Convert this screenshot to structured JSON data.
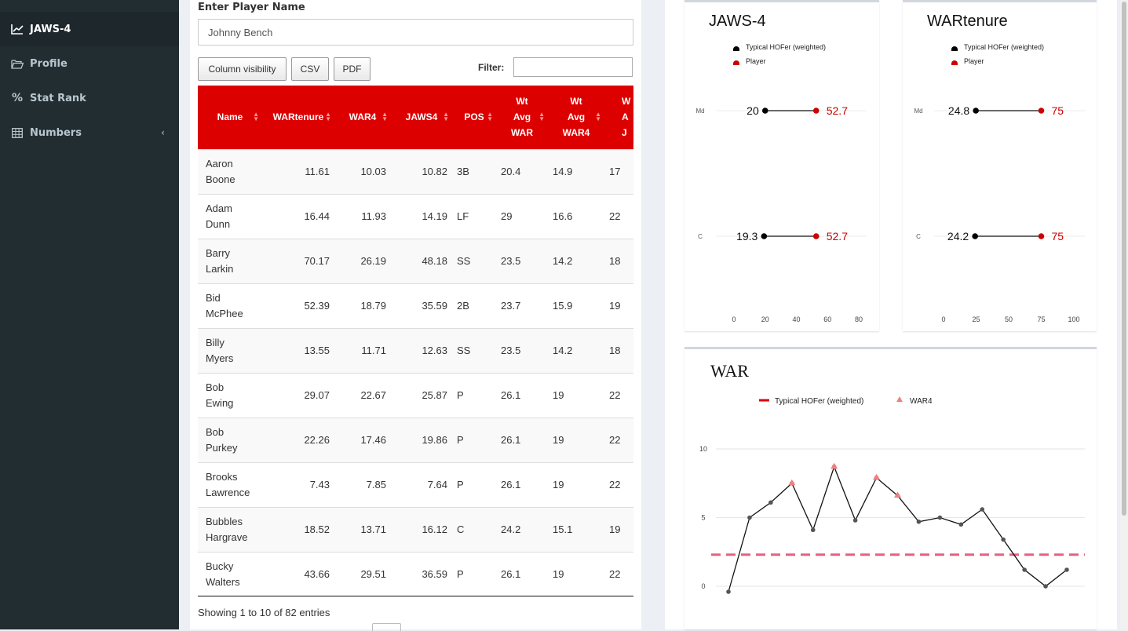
{
  "sidebar": {
    "items": [
      {
        "label": "JAWS-4",
        "icon": "line-chart-icon",
        "active": true
      },
      {
        "label": "Profile",
        "icon": "folder-open-icon"
      },
      {
        "label": "Stat Rank",
        "icon": "percent-icon"
      },
      {
        "label": "Numbers",
        "icon": "table-icon",
        "chevron": "‹"
      }
    ]
  },
  "player": {
    "label": "Enter Player Name",
    "value": "Johnny Bench"
  },
  "toolbar": {
    "colvis_label": "Column visibility",
    "csv_label": "CSV",
    "pdf_label": "PDF",
    "filter_label": "Filter:",
    "filter_value": ""
  },
  "table": {
    "headers": [
      "Name",
      "WARtenure",
      "WAR4",
      "JAWS4",
      "POS",
      "Wt Avg WAR",
      "Wt Avg WAR4",
      "W A J"
    ],
    "rows": [
      {
        "name": [
          "Aaron",
          "Boone"
        ],
        "wartenure": "11.61",
        "war4": "10.03",
        "jaws4": "10.82",
        "pos": "3B",
        "wtavgwar": "20.4",
        "wtavgwar4": "14.9",
        "last": "17"
      },
      {
        "name": [
          "Adam",
          "Dunn"
        ],
        "wartenure": "16.44",
        "war4": "11.93",
        "jaws4": "14.19",
        "pos": "LF",
        "wtavgwar": "29",
        "wtavgwar4": "16.6",
        "last": "22"
      },
      {
        "name": [
          "Barry",
          "Larkin"
        ],
        "wartenure": "70.17",
        "war4": "26.19",
        "jaws4": "48.18",
        "pos": "SS",
        "wtavgwar": "23.5",
        "wtavgwar4": "14.2",
        "last": "18"
      },
      {
        "name": [
          "Bid",
          "McPhee"
        ],
        "wartenure": "52.39",
        "war4": "18.79",
        "jaws4": "35.59",
        "pos": "2B",
        "wtavgwar": "23.7",
        "wtavgwar4": "15.9",
        "last": "19"
      },
      {
        "name": [
          "Billy",
          "Myers"
        ],
        "wartenure": "13.55",
        "war4": "11.71",
        "jaws4": "12.63",
        "pos": "SS",
        "wtavgwar": "23.5",
        "wtavgwar4": "14.2",
        "last": "18"
      },
      {
        "name": [
          "Bob",
          "Ewing"
        ],
        "wartenure": "29.07",
        "war4": "22.67",
        "jaws4": "25.87",
        "pos": "P",
        "wtavgwar": "26.1",
        "wtavgwar4": "19",
        "last": "22"
      },
      {
        "name": [
          "Bob",
          "Purkey"
        ],
        "wartenure": "22.26",
        "war4": "17.46",
        "jaws4": "19.86",
        "pos": "P",
        "wtavgwar": "26.1",
        "wtavgwar4": "19",
        "last": "22"
      },
      {
        "name": [
          "Brooks",
          "Lawrence"
        ],
        "wartenure": "7.43",
        "war4": "7.85",
        "jaws4": "7.64",
        "pos": "P",
        "wtavgwar": "26.1",
        "wtavgwar4": "19",
        "last": "22"
      },
      {
        "name": [
          "Bubbles",
          "Hargrave"
        ],
        "wartenure": "18.52",
        "war4": "13.71",
        "jaws4": "16.12",
        "pos": "C",
        "wtavgwar": "24.2",
        "wtavgwar4": "15.1",
        "last": "19"
      },
      {
        "name": [
          "Bucky",
          "Walters"
        ],
        "wartenure": "43.66",
        "war4": "29.51",
        "jaws4": "36.59",
        "pos": "P",
        "wtavgwar": "26.1",
        "wtavgwar4": "19",
        "last": "22"
      }
    ],
    "info": "Showing 1 to 10 of 82 entries"
  },
  "colors": {
    "accent": "#dd0000",
    "player": "#cc0000",
    "typical": "#000000",
    "war4_marker": "#f08080",
    "hof_line": "#e8607e"
  },
  "chart_data": [
    {
      "type": "dumbbell",
      "title": "JAWS-4",
      "legend": [
        "Typical HOFer (weighted)",
        "Player"
      ],
      "categories": [
        "Md",
        "C"
      ],
      "series": [
        {
          "name": "Typical HOFer (weighted)",
          "values": [
            20,
            19.3
          ]
        },
        {
          "name": "Player",
          "values": [
            52.7,
            52.7
          ]
        }
      ],
      "xticks": [
        0,
        20,
        40,
        60,
        80
      ],
      "xlim": [
        0,
        80
      ]
    },
    {
      "type": "dumbbell",
      "title": "WARtenure",
      "legend": [
        "Typical HOFer (weighted)",
        "Player"
      ],
      "categories": [
        "Md",
        "C"
      ],
      "series": [
        {
          "name": "Typical HOFer (weighted)",
          "values": [
            24.8,
            24.2
          ]
        },
        {
          "name": "Player",
          "values": [
            75,
            75
          ]
        }
      ],
      "xticks": [
        0,
        25,
        50,
        75,
        100
      ],
      "xlim": [
        0,
        100
      ]
    },
    {
      "type": "line",
      "title": "WAR",
      "legend": [
        "Typical HOFer (weighted)",
        "WAR4"
      ],
      "x": [
        1,
        2,
        3,
        4,
        5,
        6,
        7,
        8,
        9,
        10,
        11,
        12,
        13,
        14,
        15,
        16,
        17
      ],
      "series": [
        {
          "name": "WAR",
          "values": [
            -0.4,
            5.0,
            6.1,
            7.5,
            4.1,
            8.7,
            4.8,
            7.9,
            6.6,
            4.7,
            5.0,
            4.5,
            5.6,
            3.4,
            1.2,
            0.0,
            1.2
          ]
        },
        {
          "name": "WAR4",
          "x": [
            4,
            6,
            8,
            9
          ],
          "values": [
            7.5,
            8.7,
            7.9,
            6.6
          ]
        },
        {
          "name": "Typical HOFer (weighted)",
          "values": [
            2.3
          ]
        }
      ],
      "yticks": [
        0,
        5,
        10
      ],
      "ylim": [
        -0.6,
        10.5
      ]
    }
  ]
}
